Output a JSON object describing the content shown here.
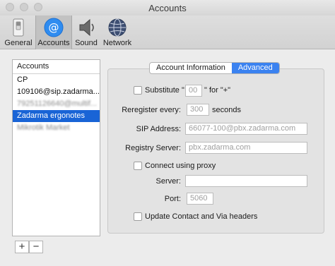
{
  "window": {
    "title": "Accounts"
  },
  "toolbar": {
    "items": [
      {
        "label": "General",
        "icon": "general-switch-icon"
      },
      {
        "label": "Accounts",
        "icon": "at-sign-icon"
      },
      {
        "label": "Sound",
        "icon": "speaker-icon"
      },
      {
        "label": "Network",
        "icon": "globe-icon"
      }
    ],
    "selected": "Accounts"
  },
  "accounts": {
    "header": "Accounts",
    "rows": [
      {
        "label": "CP"
      },
      {
        "label": "109106@sip.zadarma..."
      },
      {
        "label": "79251126640@multif..."
      },
      {
        "label": "Zadarma ergonotes"
      },
      {
        "label": "Mikrotik Market"
      }
    ],
    "add_label": "+",
    "remove_label": "−"
  },
  "tabs": {
    "items": [
      "Account Information",
      "Advanced"
    ],
    "selected": "Advanced"
  },
  "form": {
    "substitute": {
      "label": "Substitute \"",
      "placeholder": "00",
      "after": "\" for \"+\""
    },
    "reregister": {
      "label": "Reregister every:",
      "placeholder": "300",
      "unit": "seconds"
    },
    "sip_address": {
      "label": "SIP Address:",
      "placeholder": "66077-100@pbx.zadarma.com"
    },
    "registry_server": {
      "label": "Registry Server:",
      "placeholder": "pbx.zadarma.com"
    },
    "connect_proxy": {
      "label": "Connect using proxy"
    },
    "server": {
      "label": "Server:",
      "value": ""
    },
    "port": {
      "label": "Port:",
      "placeholder": "5060"
    },
    "update_headers": {
      "label": "Update Contact and Via headers"
    }
  },
  "colors": {
    "accent": "#1964d6",
    "segment_on": "#3b82f0"
  }
}
